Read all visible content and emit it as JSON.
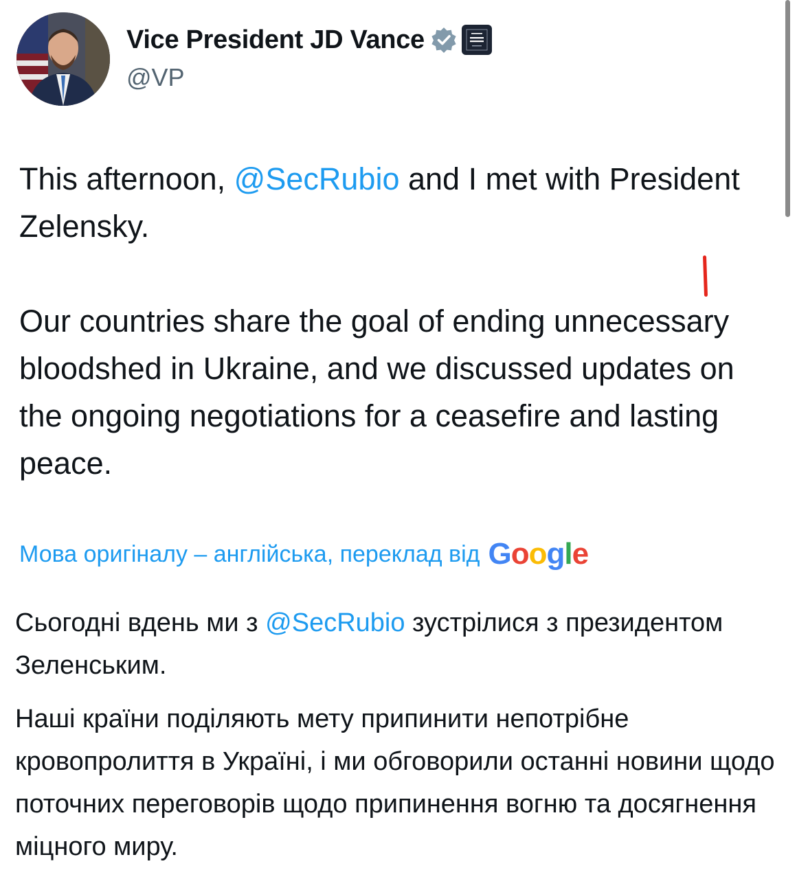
{
  "author": {
    "display_name": "Vice President JD Vance",
    "handle": "@VP",
    "avatar_icon": "profile-photo",
    "verified_icon": "verified-badge-icon",
    "affiliate_badge_text": "The WHITE HOUSE"
  },
  "post": {
    "para1_before": "This afternoon, ",
    "para1_mention": "@SecRubio",
    "para1_after": " and I met with President Zelensky.",
    "para2": "Our countries share the goal of ending unnecessary bloodshed in Ukraine, and we discussed updates on the ongoing negotiations for a ceasefire and lasting peace."
  },
  "translation": {
    "notice": "Мова оригіналу – англійська, переклад від",
    "provider": "Google",
    "para1_before": "Сьогодні вдень ми з ",
    "para1_mention": "@SecRubio",
    "para1_after": " зустрілися з президентом Зеленським.",
    "para2": "Наші країни поділяють мету припинити непотрібне кровопролиття в Україні, і ми обговорили останні новини щодо поточних переговорів щодо припинення вогню та досягнення міцного миру."
  },
  "colors": {
    "link": "#1d9bf0",
    "text": "#0f1419",
    "secondary_text": "#536471",
    "annotation_mark": "#e5261c"
  }
}
